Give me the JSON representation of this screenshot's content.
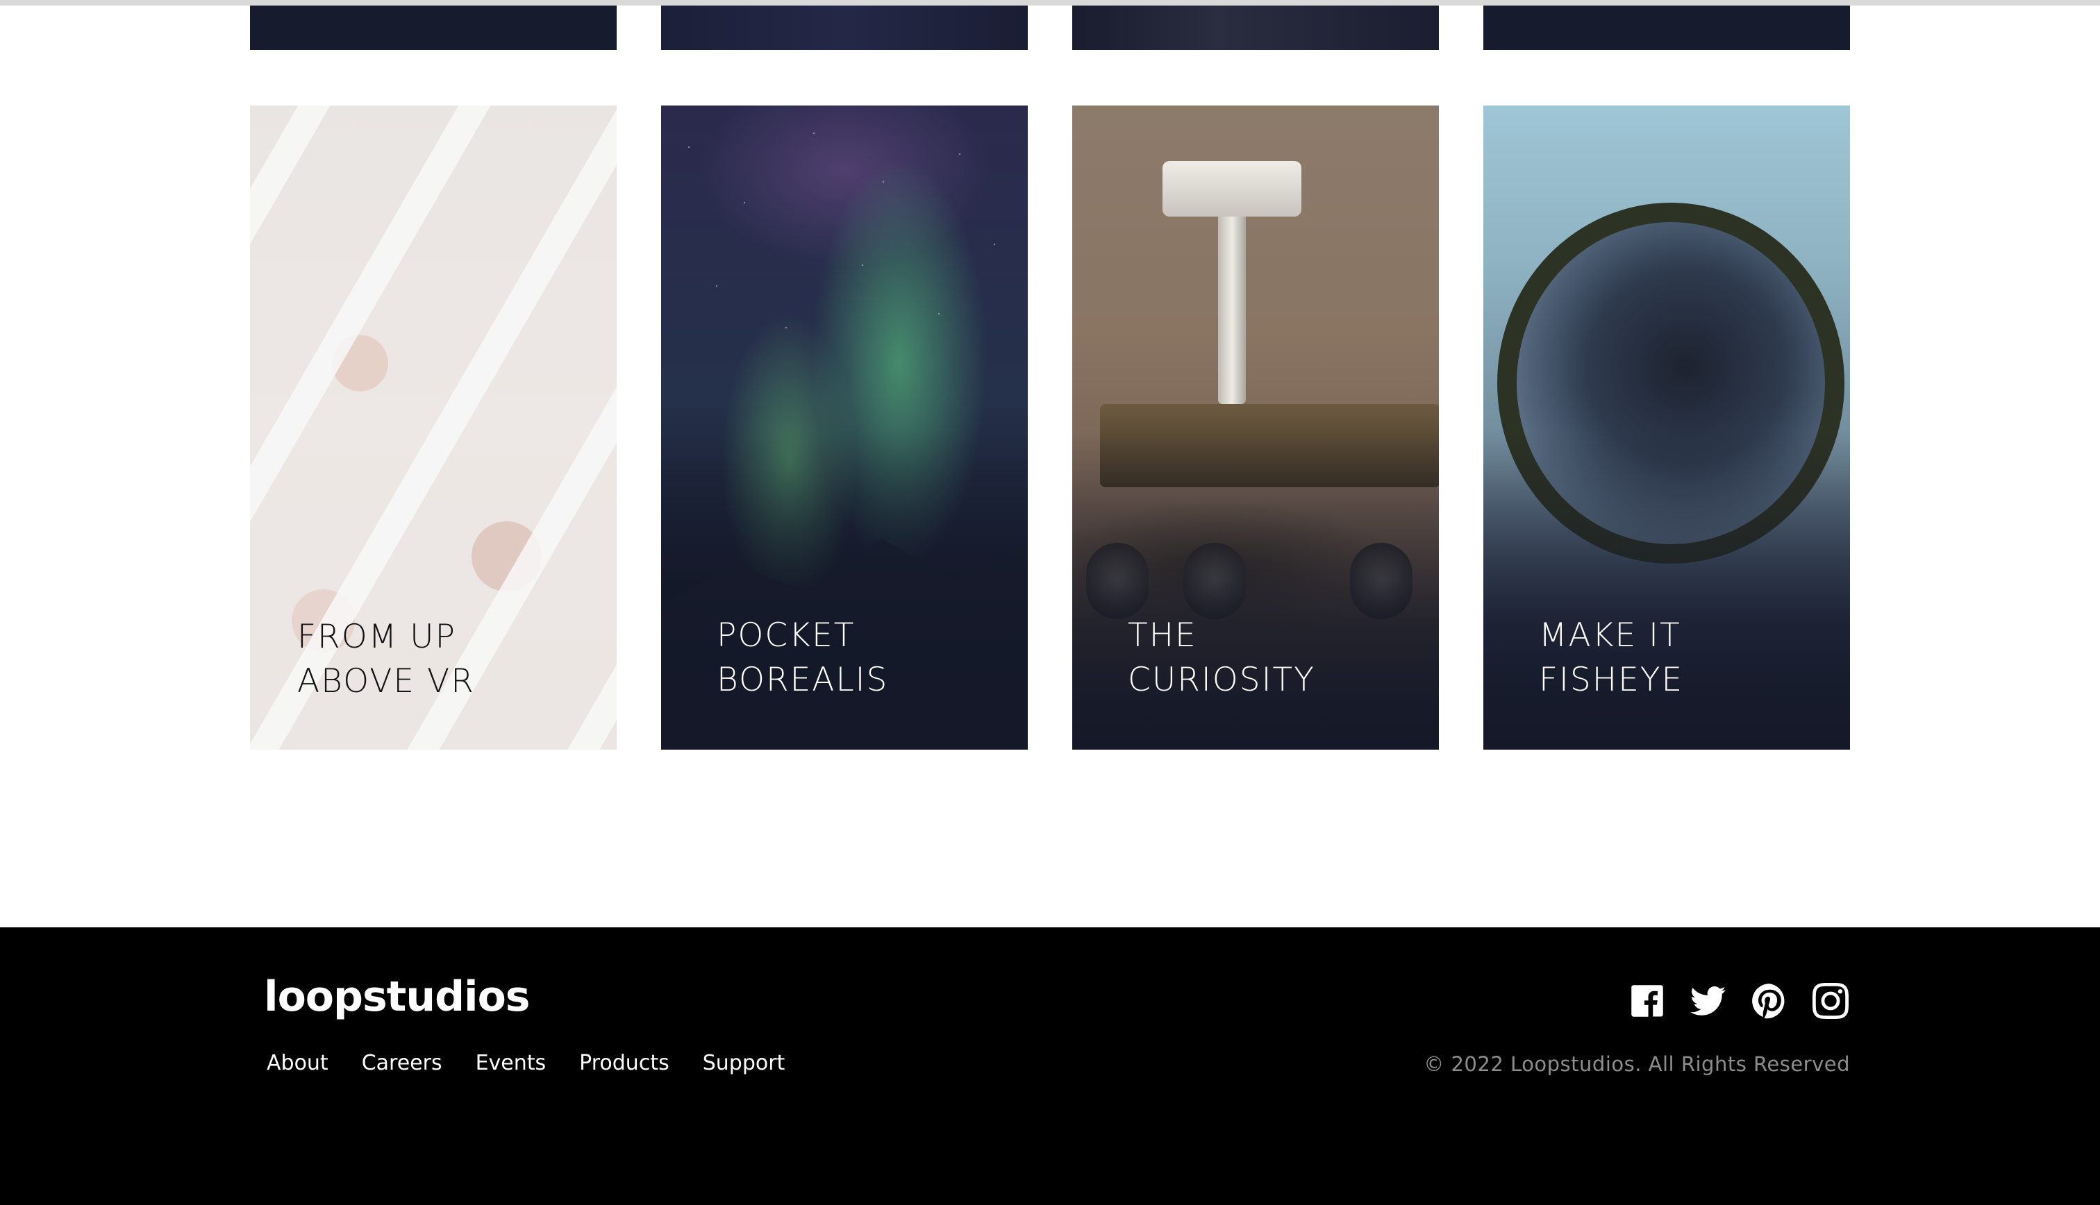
{
  "creations": {
    "top_row_count": 4,
    "cards": [
      {
        "line1": "FROM UP",
        "line2": "ABOVE VR"
      },
      {
        "line1": "POCKET",
        "line2": "BOREALIS"
      },
      {
        "line1": "THE",
        "line2": "CURIOSITY"
      },
      {
        "line1": "MAKE IT",
        "line2": "FISHEYE"
      }
    ]
  },
  "footer": {
    "logo": "loopstudios",
    "nav": [
      "About",
      "Careers",
      "Events",
      "Products",
      "Support"
    ],
    "social": [
      "facebook-icon",
      "twitter-icon",
      "pinterest-icon",
      "instagram-icon"
    ],
    "copyright": "© 2022 Loopstudios. All Rights Reserved"
  },
  "colors": {
    "footer_bg": "#000000",
    "card_dark": "#161b2e",
    "copyright_text": "#8d8d8d"
  }
}
